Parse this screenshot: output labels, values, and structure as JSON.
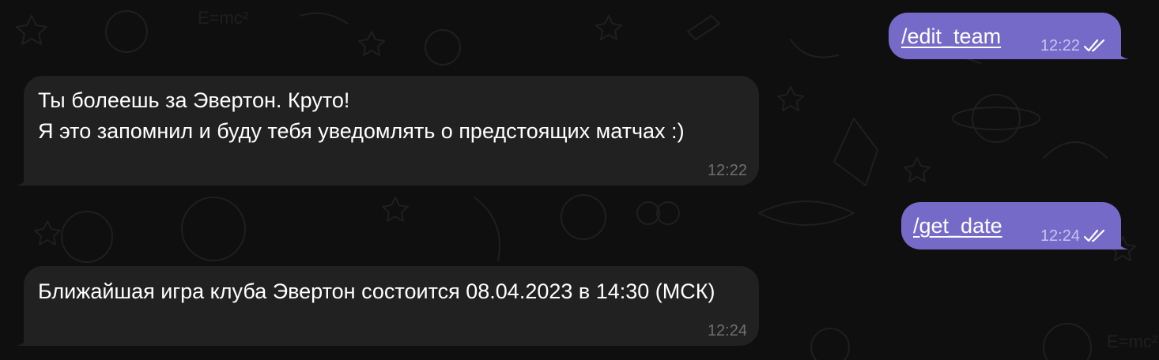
{
  "chat": {
    "messages": [
      {
        "direction": "outgoing",
        "text": "/edit_team",
        "time": "12:22",
        "status_icon": "double-check-icon"
      },
      {
        "direction": "incoming",
        "text": "Ты болеешь за Эвертон. Круто!\nЯ это запомнил и буду тебя уведомлять о предстоящих матчах :)",
        "time": "12:22"
      },
      {
        "direction": "outgoing",
        "text": "/get_date",
        "time": "12:24",
        "status_icon": "double-check-icon"
      },
      {
        "direction": "incoming",
        "text": "Ближайшая игра клуба Эвертон состоится 08.04.2023 в 14:30 (МСК)",
        "time": "12:24"
      }
    ]
  },
  "colors": {
    "background": "#0f0f10",
    "incoming_bubble": "#212121",
    "outgoing_bubble": "#766ac8",
    "incoming_time": "#6f6f6f",
    "outgoing_time": "#c9c2f2"
  }
}
